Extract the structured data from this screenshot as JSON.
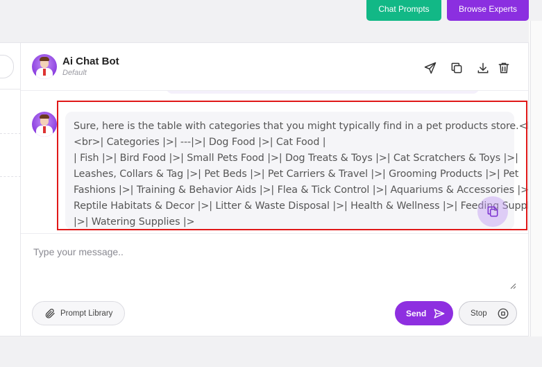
{
  "top_buttons": {
    "chat_prompts": "Chat Prompts",
    "browse_experts": "Browse Experts"
  },
  "header": {
    "bot_name": "Ai Chat Bot",
    "bot_subtitle": "Default",
    "icons": [
      "send-icon",
      "copy-icon",
      "download-icon",
      "trash-icon"
    ]
  },
  "message": {
    "lines": [
      "Sure, here is the table with categories that you might typically find in a pet products store.<br>",
      "<br>| Categories |>| ---|>| Dog Food |>| Cat Food |",
      "| Fish |>| Bird Food |>| Small Pets Food |>| Dog Treats & Toys |>| Cat Scratchers & Toys |>|",
      "Leashes, Collars & Tag |>| Pet Beds |>| Pet Carriers & Travel |>| Grooming Products |>| Pet",
      "Fashions |>| Training & Behavior Aids |>| Flea & Tick Control |>| Aquariums & Accessories |>|",
      "Reptile Habitats & Decor |>| Litter & Waste Disposal |>| Health & Wellness |>| Feeding Supplies",
      "|>| Watering Supplies |>"
    ]
  },
  "input": {
    "placeholder": "Type your message..",
    "value": ""
  },
  "actions": {
    "prompt_library": "Prompt Library",
    "send": "Send",
    "stop": "Stop"
  },
  "colors": {
    "accent": "#8e2fe0",
    "chat_prompts_green": "#12b886",
    "highlight": "#e01717"
  }
}
